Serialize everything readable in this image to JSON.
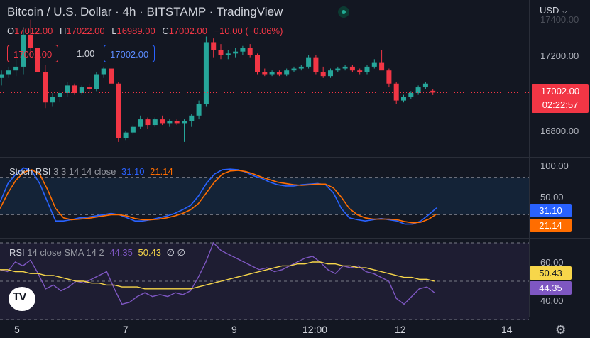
{
  "header": {
    "title": "Bitcoin / U.S. Dollar · 4h · BITSTAMP · TradingView",
    "currency": "USD"
  },
  "ohlc": {
    "o_label": "O",
    "o": "17012.00",
    "h_label": "H",
    "h": "17022.00",
    "l_label": "L",
    "l": "16989.00",
    "c_label": "C",
    "c": "17002.00",
    "change": "−10.00 (−0.06%)"
  },
  "order": {
    "sell": "17001.00",
    "spread": "1.00",
    "buy": "17002.00"
  },
  "price_badge": {
    "price": "17002.00",
    "countdown": "02:22:57"
  },
  "stoch": {
    "label": "Stoch RSI",
    "params": "3 3 14 14 close",
    "k": "31.10",
    "d": "21.14"
  },
  "rsi": {
    "label": "RSI",
    "params": "14 close SMA 14 2",
    "value": "44.35",
    "sma": "50.43",
    "extra": "∅ ∅"
  },
  "colors": {
    "background": "#131722",
    "up": "#26a69a",
    "down": "#f23645",
    "stoch_k": "#2962ff",
    "stoch_d": "#ff6d00",
    "rsi": "#7e57c2",
    "rsi_sma": "#f7d64a"
  },
  "chart_data": [
    {
      "type": "candlestick",
      "title": "Bitcoin / U.S. Dollar · 4h · BITSTAMP · TradingView",
      "ytick_labels": [
        "16800.00",
        "17200.00"
      ],
      "yticks": [
        16800,
        17200
      ],
      "xtick_labels": [
        "5",
        "7",
        "9",
        "12:00",
        "12",
        "14"
      ],
      "xtick_index": [
        3,
        15,
        27,
        38,
        47,
        59
      ],
      "current_price": 17002,
      "candles": [
        {
          "o": 17080,
          "h": 17120,
          "l": 17040,
          "c": 17100
        },
        {
          "o": 17100,
          "h": 17140,
          "l": 17080,
          "c": 17120
        },
        {
          "o": 17120,
          "h": 17180,
          "l": 17090,
          "c": 17140
        },
        {
          "o": 17140,
          "h": 17350,
          "l": 17100,
          "c": 17310
        },
        {
          "o": 17310,
          "h": 17390,
          "l": 17200,
          "c": 17240
        },
        {
          "o": 17240,
          "h": 17280,
          "l": 17080,
          "c": 17110
        },
        {
          "o": 17110,
          "h": 17150,
          "l": 16920,
          "c": 16950
        },
        {
          "o": 16950,
          "h": 17000,
          "l": 16930,
          "c": 16980
        },
        {
          "o": 16980,
          "h": 17010,
          "l": 16950,
          "c": 17000
        },
        {
          "o": 17000,
          "h": 17060,
          "l": 16980,
          "c": 17040
        },
        {
          "o": 17040,
          "h": 17050,
          "l": 16990,
          "c": 17000
        },
        {
          "o": 17000,
          "h": 17040,
          "l": 16990,
          "c": 17030
        },
        {
          "o": 17030,
          "h": 17050,
          "l": 17000,
          "c": 17020
        },
        {
          "o": 17020,
          "h": 17110,
          "l": 17010,
          "c": 17100
        },
        {
          "o": 17100,
          "h": 17140,
          "l": 17080,
          "c": 17130
        },
        {
          "o": 17130,
          "h": 17150,
          "l": 17020,
          "c": 17050
        },
        {
          "o": 17050,
          "h": 17060,
          "l": 16740,
          "c": 16760
        },
        {
          "o": 16760,
          "h": 16800,
          "l": 16750,
          "c": 16790
        },
        {
          "o": 16790,
          "h": 16830,
          "l": 16780,
          "c": 16820
        },
        {
          "o": 16820,
          "h": 16880,
          "l": 16810,
          "c": 16860
        },
        {
          "o": 16860,
          "h": 16870,
          "l": 16810,
          "c": 16830
        },
        {
          "o": 16830,
          "h": 16870,
          "l": 16820,
          "c": 16860
        },
        {
          "o": 16860,
          "h": 16880,
          "l": 16830,
          "c": 16840
        },
        {
          "o": 16840,
          "h": 16860,
          "l": 16820,
          "c": 16850
        },
        {
          "o": 16850,
          "h": 16860,
          "l": 16830,
          "c": 16840
        },
        {
          "o": 16840,
          "h": 16860,
          "l": 16740,
          "c": 16850
        },
        {
          "o": 16850,
          "h": 16890,
          "l": 16820,
          "c": 16880
        },
        {
          "o": 16880,
          "h": 16960,
          "l": 16860,
          "c": 16940
        },
        {
          "o": 16940,
          "h": 17300,
          "l": 16930,
          "c": 17270
        },
        {
          "o": 17270,
          "h": 17290,
          "l": 17190,
          "c": 17230
        },
        {
          "o": 17230,
          "h": 17260,
          "l": 17180,
          "c": 17200
        },
        {
          "o": 17200,
          "h": 17230,
          "l": 17180,
          "c": 17210
        },
        {
          "o": 17210,
          "h": 17240,
          "l": 17190,
          "c": 17220
        },
        {
          "o": 17220,
          "h": 17250,
          "l": 17200,
          "c": 17240
        },
        {
          "o": 17240,
          "h": 17260,
          "l": 17190,
          "c": 17200
        },
        {
          "o": 17200,
          "h": 17210,
          "l": 17100,
          "c": 17110
        },
        {
          "o": 17110,
          "h": 17130,
          "l": 17090,
          "c": 17100
        },
        {
          "o": 17100,
          "h": 17120,
          "l": 17090,
          "c": 17110
        },
        {
          "o": 17110,
          "h": 17120,
          "l": 17090,
          "c": 17100
        },
        {
          "o": 17100,
          "h": 17130,
          "l": 17090,
          "c": 17120
        },
        {
          "o": 17120,
          "h": 17140,
          "l": 17110,
          "c": 17130
        },
        {
          "o": 17130,
          "h": 17150,
          "l": 17120,
          "c": 17140
        },
        {
          "o": 17140,
          "h": 17200,
          "l": 17130,
          "c": 17190
        },
        {
          "o": 17190,
          "h": 17200,
          "l": 17100,
          "c": 17110
        },
        {
          "o": 17110,
          "h": 17140,
          "l": 17080,
          "c": 17090
        },
        {
          "o": 17090,
          "h": 17130,
          "l": 17080,
          "c": 17120
        },
        {
          "o": 17120,
          "h": 17140,
          "l": 17110,
          "c": 17130
        },
        {
          "o": 17130,
          "h": 17150,
          "l": 17120,
          "c": 17140
        },
        {
          "o": 17140,
          "h": 17150,
          "l": 17110,
          "c": 17120
        },
        {
          "o": 17120,
          "h": 17130,
          "l": 17100,
          "c": 17110
        },
        {
          "o": 17110,
          "h": 17150,
          "l": 17100,
          "c": 17140
        },
        {
          "o": 17140,
          "h": 17180,
          "l": 17130,
          "c": 17160
        },
        {
          "o": 17160,
          "h": 17230,
          "l": 17150,
          "c": 17120
        },
        {
          "o": 17120,
          "h": 17130,
          "l": 17030,
          "c": 17050
        },
        {
          "o": 17050,
          "h": 17060,
          "l": 16940,
          "c": 16960
        },
        {
          "o": 16960,
          "h": 16990,
          "l": 16950,
          "c": 16980
        },
        {
          "o": 16980,
          "h": 17010,
          "l": 16970,
          "c": 17000
        },
        {
          "o": 17000,
          "h": 17040,
          "l": 16990,
          "c": 17030
        },
        {
          "o": 17030,
          "h": 17060,
          "l": 17020,
          "c": 17050
        },
        {
          "o": 17012,
          "h": 17022,
          "l": 16989,
          "c": 17002
        }
      ]
    },
    {
      "type": "line",
      "title": "Stoch RSI 3 3 14 14 close",
      "ytick_labels": [
        "100.00",
        "50.00"
      ],
      "yticks": [
        100,
        50
      ],
      "bands": [
        80,
        20
      ],
      "ylim": [
        0,
        100
      ],
      "series": [
        {
          "name": "K",
          "values": [
            40,
            70,
            85,
            95,
            90,
            70,
            40,
            10,
            10,
            12,
            15,
            16,
            18,
            20,
            22,
            20,
            15,
            10,
            10,
            12,
            15,
            18,
            22,
            28,
            35,
            50,
            70,
            85,
            92,
            93,
            92,
            88,
            82,
            78,
            72,
            68,
            66,
            66,
            68,
            69,
            70,
            68,
            55,
            30,
            15,
            12,
            10,
            12,
            14,
            12,
            10,
            5,
            5,
            10,
            20,
            31
          ]
        },
        {
          "name": "D",
          "values": [
            30,
            55,
            75,
            88,
            92,
            85,
            60,
            30,
            15,
            12,
            13,
            14,
            16,
            18,
            20,
            20,
            18,
            14,
            12,
            12,
            13,
            15,
            18,
            22,
            28,
            38,
            55,
            72,
            85,
            90,
            91,
            89,
            85,
            80,
            76,
            72,
            70,
            68,
            67,
            68,
            69,
            69,
            63,
            48,
            30,
            20,
            15,
            13,
            13,
            13,
            12,
            9,
            7,
            8,
            13,
            21
          ]
        }
      ]
    },
    {
      "type": "line",
      "title": "RSI 14 close SMA 14 2",
      "ytick_labels": [
        "60.00",
        "40.00"
      ],
      "yticks": [
        60,
        40
      ],
      "bands": [
        70,
        50,
        30
      ],
      "ylim": [
        30,
        72
      ],
      "series": [
        {
          "name": "RSI",
          "values": [
            56,
            55,
            60,
            58,
            61,
            54,
            46,
            48,
            45,
            47,
            50,
            49,
            51,
            53,
            55,
            46,
            38,
            39,
            42,
            44,
            42,
            43,
            42,
            44,
            43,
            45,
            52,
            60,
            70,
            66,
            64,
            62,
            60,
            58,
            56,
            57,
            55,
            56,
            58,
            60,
            62,
            63,
            60,
            56,
            54,
            58,
            57,
            58,
            55,
            54,
            52,
            50,
            41,
            38,
            42,
            46,
            47,
            44
          ]
        },
        {
          "name": "SMA",
          "values": [
            56,
            56,
            55,
            55,
            54,
            54,
            53,
            53,
            52,
            51,
            50,
            50,
            49,
            49,
            48,
            48,
            47,
            47,
            47,
            46,
            46,
            46,
            46,
            46,
            46,
            46,
            47,
            48,
            49,
            50,
            51,
            52,
            53,
            54,
            55,
            56,
            57,
            58,
            58,
            59,
            59,
            60,
            60,
            59,
            59,
            58,
            58,
            57,
            57,
            56,
            55,
            54,
            53,
            52,
            52,
            51,
            51,
            50
          ]
        }
      ]
    }
  ]
}
